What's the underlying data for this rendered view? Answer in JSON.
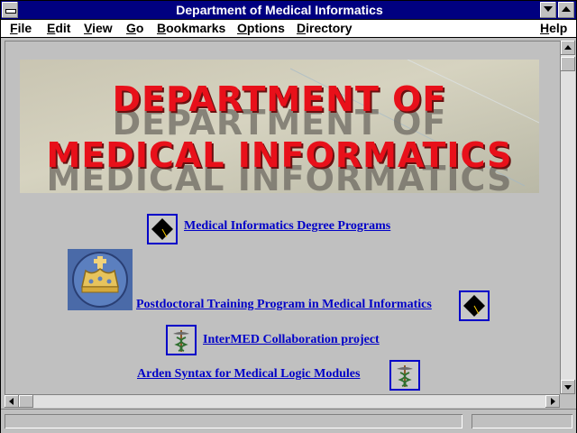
{
  "window": {
    "title": "Department of Medical Informatics"
  },
  "menu": [
    {
      "label": "File",
      "hotkey_index": 0
    },
    {
      "label": "Edit",
      "hotkey_index": 0
    },
    {
      "label": "View",
      "hotkey_index": 0
    },
    {
      "label": "Go",
      "hotkey_index": 0
    },
    {
      "label": "Bookmarks",
      "hotkey_index": 0
    },
    {
      "label": "Options",
      "hotkey_index": 0
    },
    {
      "label": "Directory",
      "hotkey_index": 0
    },
    {
      "label": "Help",
      "hotkey_index": 0
    }
  ],
  "banner": {
    "line1": "DEPARTMENT OF",
    "line2": "MEDICAL INFORMATICS"
  },
  "links": {
    "degree_programs": "Medical Informatics Degree Programs",
    "postdoc": "Postdoctoral Training Program in Medical Informatics",
    "intermed": "InterMED Collaboration project",
    "arden": "Arden Syntax for Medical Logic Modules"
  },
  "icons": {
    "degree_programs": "mortarboard-icon",
    "postdoc_seal": "crown-seal-icon",
    "postdoc": "mortarboard-icon",
    "intermed": "caduceus-icon",
    "arden": "caduceus-icon"
  },
  "colors": {
    "titlebar": "#000080",
    "link": "#0000c8",
    "banner_text": "#e8101a",
    "background": "#c0c0c0"
  }
}
